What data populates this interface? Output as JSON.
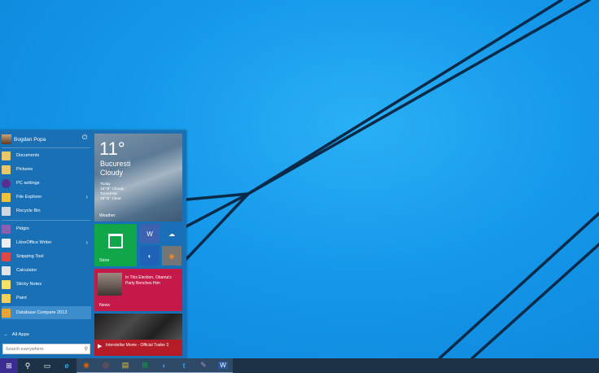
{
  "user": {
    "name": "Bogdan Popa",
    "power_icon": "power-icon"
  },
  "places": [
    {
      "label": "Documents",
      "icon": "documents-icon",
      "color": "#e8c66a",
      "arrow": false
    },
    {
      "label": "Pictures",
      "icon": "pictures-icon",
      "color": "#e8c66a",
      "arrow": false
    },
    {
      "label": "PC settings",
      "icon": "gear-icon",
      "color": "#5a2d91",
      "arrow": false
    },
    {
      "label": "File Explorer",
      "icon": "folder-icon",
      "color": "#f0c23b",
      "arrow": true
    },
    {
      "label": "Recycle Bin",
      "icon": "recycle-bin-icon",
      "color": "#cfd8e0",
      "arrow": false
    }
  ],
  "apps": [
    {
      "label": "Pidgin",
      "icon": "pidgin-icon",
      "color": "#8d5fb0",
      "arrow": false
    },
    {
      "label": "LibreOffice Writer",
      "icon": "writer-icon",
      "color": "#e9eef5",
      "arrow": true
    },
    {
      "label": "Snipping Tool",
      "icon": "scissors-icon",
      "color": "#e04848",
      "arrow": false
    },
    {
      "label": "Calculator",
      "icon": "calculator-icon",
      "color": "#dfe4e8",
      "arrow": false
    },
    {
      "label": "Sticky Notes",
      "icon": "sticky-notes-icon",
      "color": "#f3e26a",
      "arrow": false
    },
    {
      "label": "Paint",
      "icon": "paint-icon",
      "color": "#f2d15a",
      "arrow": false
    },
    {
      "label": "Database Compare 2013",
      "icon": "database-compare-icon",
      "color": "#e8a534",
      "arrow": false
    }
  ],
  "all_apps": {
    "arrow": "→",
    "label": "All Apps"
  },
  "search": {
    "placeholder": "Search everywhere",
    "icon": "search-icon"
  },
  "weather": {
    "temp": "11°",
    "city": "Bucuresti",
    "condition": "Cloudy",
    "today_label": "Today",
    "today": "18°/9° Cloudy",
    "tomorrow_label": "Tomorrow",
    "tomorrow": "19°/8° Clear",
    "label": "Weather"
  },
  "store": {
    "label": "Store"
  },
  "small_tiles": [
    {
      "icon": "word-icon",
      "glyph": "W",
      "color": "#3c62b0"
    },
    {
      "icon": "onedrive-icon",
      "glyph": "☁",
      "color": "#1a6fb9"
    },
    {
      "icon": "people-icon",
      "glyph": "◐",
      "color": "#1e63b8"
    },
    {
      "icon": "firefox-icon",
      "glyph": "◉",
      "color": "#757575"
    }
  ],
  "news": {
    "headline": "In This Election, Obama's Party Benches Him",
    "label": "News"
  },
  "video": {
    "headline": "Interstellar Movie - Official Trailer 3"
  },
  "taskbar": [
    {
      "icon": "start-icon",
      "glyph": "⊞",
      "color": "#3a2d91",
      "active": false
    },
    {
      "icon": "search-icon",
      "glyph": "⚲",
      "color": "",
      "active": false
    },
    {
      "icon": "task-view-icon",
      "glyph": "▭",
      "color": "",
      "active": false
    },
    {
      "icon": "internet-explorer-icon",
      "glyph": "e",
      "color": "#3aa3e3",
      "active": false
    },
    {
      "icon": "firefox-icon",
      "glyph": "◉",
      "color": "#e66000",
      "active": true
    },
    {
      "icon": "chrome-icon",
      "glyph": "◎",
      "color": "#dd4b39",
      "active": true
    },
    {
      "icon": "file-explorer-icon",
      "glyph": "▤",
      "color": "#f0c23b",
      "active": true
    },
    {
      "icon": "store-icon",
      "glyph": "⊞",
      "color": "#0fa74a",
      "active": true
    },
    {
      "icon": "people-icon",
      "glyph": "◐",
      "color": "#5b8fd6",
      "active": true
    },
    {
      "icon": "twitter-icon",
      "glyph": "t",
      "color": "#2aa3e8",
      "active": true
    },
    {
      "icon": "pidgin-icon",
      "glyph": "✎",
      "color": "#8d5fb0",
      "active": true
    },
    {
      "icon": "word-icon",
      "glyph": "W",
      "color": "#2b579a",
      "active": true
    }
  ]
}
